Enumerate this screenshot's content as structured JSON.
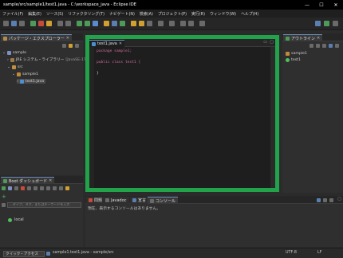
{
  "window": {
    "title": "sample/src/sample1/test1.java - C:\\workspace_java - Eclipse IDE",
    "minimize": "—",
    "maximize": "☐",
    "close": "✕"
  },
  "menu": [
    "ファイル(F)",
    "編集(E)",
    "ソース(S)",
    "リファクタリング(T)",
    "ナビゲート(N)",
    "検索(A)",
    "プロジェクト(P)",
    "実行(R)",
    "ウィンドウ(W)",
    "ヘルプ(H)"
  ],
  "package_explorer": {
    "tab": "パッケージ・エクスプローラー",
    "close": "✕",
    "tree": {
      "project": "sample",
      "jre": "JRE システム・ライブラリー",
      "jre_version": "[JavaSE-17]",
      "src": "src",
      "package": "sample1",
      "file": "test1.java"
    }
  },
  "boot_dashboard": {
    "tab": "Boot ダッシュボード",
    "close": "✕",
    "filter_placeholder": "...タイプ、タグ、またはキーワードを入力",
    "local": "local"
  },
  "editor": {
    "tab": "test1.java",
    "close": "✕",
    "code": [
      "package sample1;",
      "",
      "public class test1 {",
      "",
      "}"
    ]
  },
  "outline": {
    "tab": "アウトライン",
    "close": "✕",
    "items": [
      "sample1",
      "test1"
    ]
  },
  "console": {
    "tabs": [
      "問題",
      "Javadoc",
      "宣言",
      "コンソール"
    ],
    "message": "現在、表示するコンソールはありません。"
  },
  "statusbar": {
    "search": "クイック・アクセス",
    "path": "sample1.test1.java - sample/src",
    "encoding": "UTF-8",
    "eol": "LF"
  },
  "colors": {
    "highlight_border": "#22a24a",
    "keyword": "#cc6c9c",
    "class_name": "#8bb5e0"
  }
}
